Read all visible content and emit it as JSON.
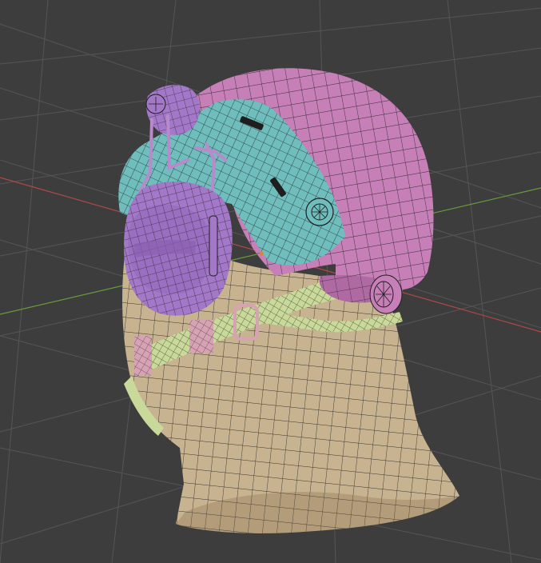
{
  "viewport": {
    "background": "#3d3d3d",
    "grid_color": "#555555",
    "axis_x_color": "#b04848",
    "axis_y_color": "#6a9a3a"
  },
  "model": {
    "helmet_shell_color": "#c77fb8",
    "helmet_rail_color": "#6fbdbd",
    "ear_cup_color": "#a478c9",
    "head_color": "#c8b391",
    "strap_color": "#c9d99a",
    "strap_buckle_color": "#d7a2b4",
    "wire_color": "#1e1e1e"
  }
}
